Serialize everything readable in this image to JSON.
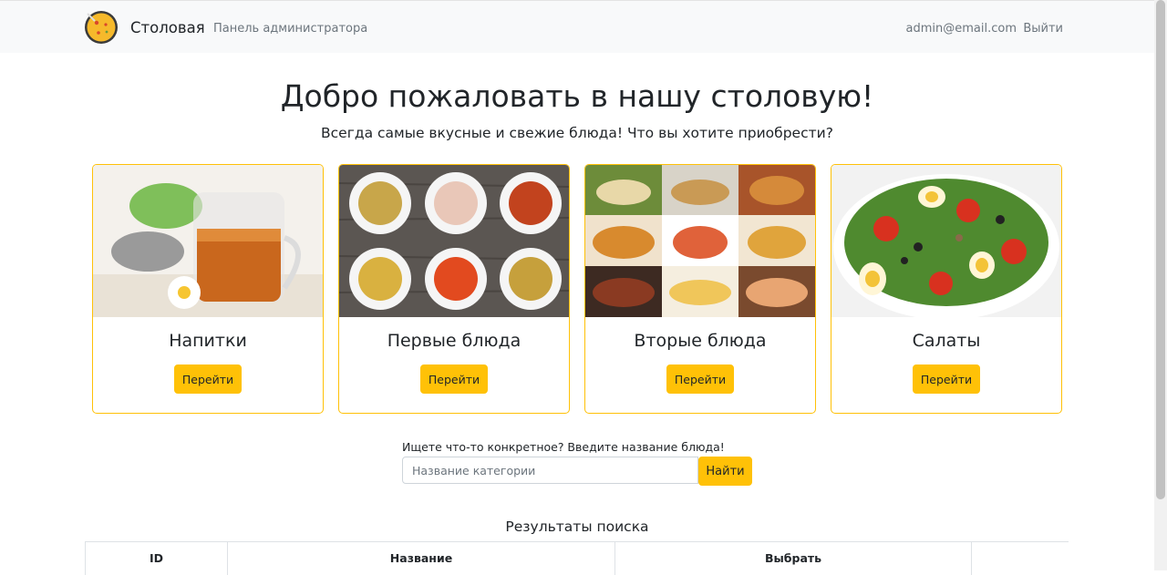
{
  "nav": {
    "brand": "Столовая",
    "admin_link": "Панель администратора",
    "user_email": "admin@email.com",
    "logout": "Выйти"
  },
  "hero": {
    "title": "Добро пожаловать в нашу столовую!",
    "subtitle": "Всегда самые вкусные и свежие блюда! Что вы хотите приобрести?"
  },
  "categories": [
    {
      "title": "Напитки",
      "button": "Перейти"
    },
    {
      "title": "Первые блюда",
      "button": "Перейти"
    },
    {
      "title": "Вторые блюда",
      "button": "Перейти"
    },
    {
      "title": "Салаты",
      "button": "Перейти"
    }
  ],
  "search": {
    "label": "Ищете что-то конкретное? Введите название блюда!",
    "placeholder": "Название категории",
    "button": "Найти"
  },
  "results": {
    "title": "Результаты поиска",
    "columns": [
      "ID",
      "Название",
      "Выбрать",
      ""
    ]
  },
  "colors": {
    "accent": "#ffc107",
    "navbar_bg": "#f8f9fa",
    "muted_text": "#6c757d"
  }
}
